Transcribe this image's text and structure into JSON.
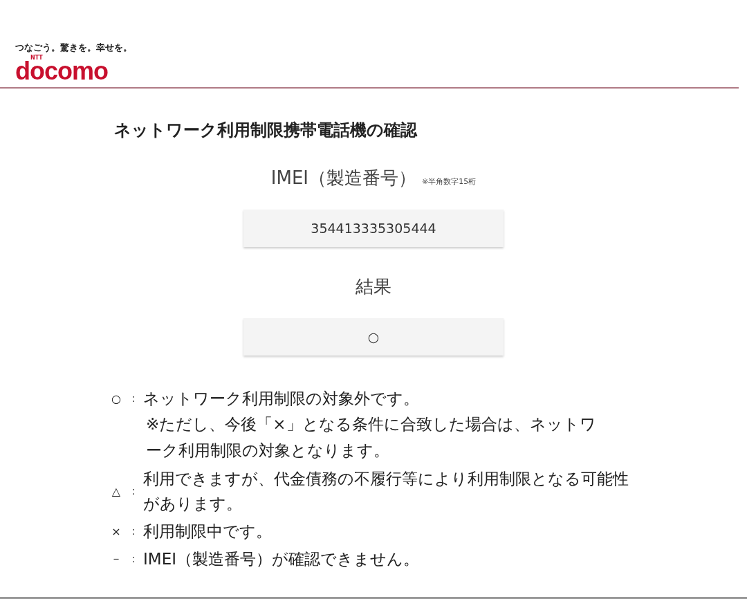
{
  "header": {
    "tagline": "つなごう。驚きを。幸せを。",
    "logo_small": "NTT",
    "logo": "docomo"
  },
  "title": "ネットワーク利用制限携帯電話機の確認",
  "imei": {
    "label": "IMEI（製造番号）",
    "hint": "※半角数字15桁",
    "value": "354413335305444"
  },
  "result": {
    "label": "結果",
    "value": "○"
  },
  "legend": [
    {
      "symbol": "○",
      "separator": "：",
      "text": "ネットワーク利用制限の対象外です。",
      "note": "※ただし、今後「×」となる条件に合致した場合は、ネットワーク利用制限の対象となります。"
    },
    {
      "symbol": "△",
      "separator": "：",
      "text": "利用できますが、代金債務の不履行等により利用制限となる可能性があります。"
    },
    {
      "symbol": "×",
      "separator": "：",
      "text": "利用制限中です。"
    },
    {
      "symbol": "－",
      "separator": "：",
      "text": "IMEI（製造番号）が確認できません。"
    }
  ]
}
